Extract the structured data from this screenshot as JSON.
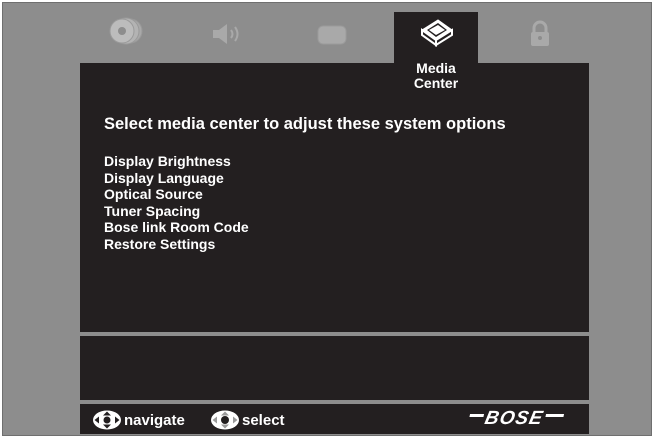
{
  "tabs": [
    {
      "icon": "disc-icon",
      "active": false
    },
    {
      "icon": "speaker-icon",
      "active": false
    },
    {
      "icon": "tv-icon",
      "active": false
    },
    {
      "icon": "media-center-icon",
      "active": true,
      "label_line1": "Media",
      "label_line2": "Center"
    },
    {
      "icon": "lock-icon",
      "active": false
    }
  ],
  "main": {
    "heading": "Select media center to adjust these system options",
    "options": [
      "Display Brightness",
      "Display Language",
      "Optical Source",
      "Tuner Spacing",
      "Bose link Room Code",
      "Restore Settings"
    ]
  },
  "footer": {
    "navigate_label": "navigate",
    "select_label": "select",
    "brand": "BOSE"
  },
  "colors": {
    "background": "#8d8d8d",
    "panel": "#231f20",
    "inactive_icon": "#a9a9a9",
    "text": "#ffffff"
  }
}
